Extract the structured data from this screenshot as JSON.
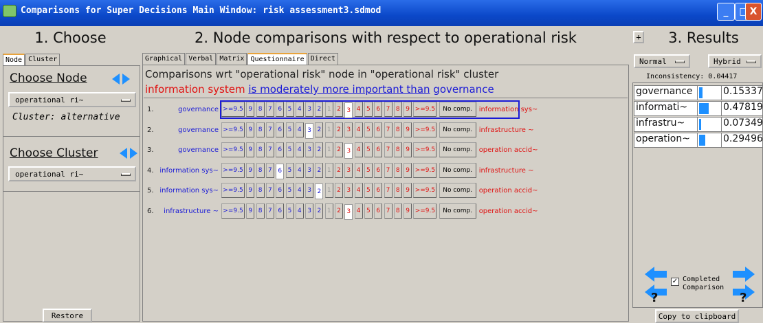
{
  "window": {
    "title": "Comparisons for Super Decisions Main Window: risk assessment3.sdmod",
    "minimize": "_",
    "maximize": "□",
    "close": "X"
  },
  "left": {
    "heading": "1. Choose",
    "tabs": [
      "Node",
      "Cluster"
    ],
    "choose_node_label": "Choose Node",
    "node_value": "operational ri~",
    "cluster_text": "Cluster: alternative",
    "choose_cluster_label": "Choose Cluster",
    "cluster_value": "operational ri~",
    "restore_label": "Restore"
  },
  "middle": {
    "heading": "2. Node comparisons with respect to operational risk",
    "tabs": [
      "Graphical",
      "Verbal",
      "Matrix",
      "Questionnaire",
      "Direct"
    ],
    "active_tab": "Questionnaire",
    "wrt_text": "Comparisons wrt \"operational risk\" node in \"operational risk\" cluster",
    "statement_left": "information system",
    "statement_mid": "is moderately more important than",
    "statement_right": "governance",
    "scale": [
      ">=9.5",
      "9",
      "8",
      "7",
      "6",
      "5",
      "4",
      "3",
      "2",
      "1",
      "2",
      "3",
      "4",
      "5",
      "6",
      "7",
      "8",
      "9",
      ">=9.5"
    ],
    "nocomp_label": "No comp.",
    "rows": [
      {
        "num": "1.",
        "left": "governance",
        "right": "information sys~",
        "selected": 11
      },
      {
        "num": "2.",
        "left": "governance",
        "right": "infrastructure ~",
        "selected": 7
      },
      {
        "num": "3.",
        "left": "governance",
        "right": "operation accid~",
        "selected": 11
      },
      {
        "num": "4.",
        "left": "information sys~",
        "right": "infrastructure ~",
        "selected": 4
      },
      {
        "num": "5.",
        "left": "information sys~",
        "right": "operation accid~",
        "selected": 8
      },
      {
        "num": "6.",
        "left": "infrastructure ~",
        "right": "operation accid~",
        "selected": 11
      }
    ]
  },
  "right": {
    "expand": "+",
    "heading": "3. Results",
    "mode1": "Normal",
    "mode2": "Hybrid",
    "inconsistency": "Inconsistency: 0.04417",
    "results": [
      {
        "name": "governance",
        "value": "0.15337",
        "bar": 0.15337
      },
      {
        "name": "informati~",
        "value": "0.47819",
        "bar": 0.47819
      },
      {
        "name": "infrastru~",
        "value": "0.07349",
        "bar": 0.07349
      },
      {
        "name": "operation~",
        "value": "0.29496",
        "bar": 0.29496
      }
    ],
    "completed_label1": "Completed",
    "completed_label2": "Comparison",
    "copy_label": "Copy to clipboard"
  },
  "colors": {
    "title_bar": "#0b48c9",
    "blue_text": "#1a1ad6",
    "red_text": "#e01010",
    "bar": "#1e90ff"
  }
}
